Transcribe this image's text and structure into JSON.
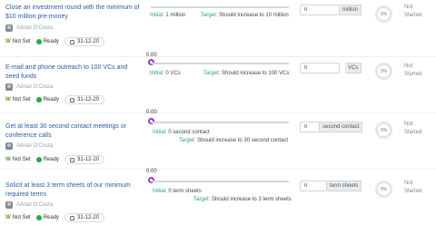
{
  "rows": [
    {
      "title": "Close an investment round with the minimum of $10 million pre-money",
      "owner": "Adrian D'Costa",
      "w_label": "W",
      "not_set": "Not Set",
      "ready": "Ready",
      "date": "31-12-20",
      "slider_value": "0.00",
      "initial_label": "Initial:",
      "initial_value": "1 million",
      "target_label": "Target:",
      "target_value": "Should increase to 10 million",
      "input_value": "0",
      "unit": "million",
      "progress": "0%",
      "status": "Not Started"
    },
    {
      "title": "E-mail and phone outreach to 100 VCs and seed funds",
      "owner": "Adrian D'Costa",
      "w_label": "W",
      "not_set": "Not Set",
      "ready": "Ready",
      "date": "31-12-20",
      "slider_value": "0.00",
      "initial_label": "Initial:",
      "initial_value": "0 VCs",
      "target_label": "Target:",
      "target_value": "Should increase to 100 VCs",
      "input_value": "0",
      "unit": "VCs",
      "progress": "0%",
      "status": "Not Started"
    },
    {
      "title": "Get at least 30 second contact meetings or conference calls",
      "owner": "Adrian D'Costa",
      "w_label": "W",
      "not_set": "Not Set",
      "ready": "Ready",
      "date": "31-12-20",
      "slider_value": "0.00",
      "initial_label": "Initial:",
      "initial_value": "0 second contact",
      "target_label": "Target:",
      "target_value": "Should increase to 30 second contact",
      "input_value": "0",
      "unit": "second contact",
      "progress": "0%",
      "status": "Not Started"
    },
    {
      "title": "Solicit at least 3 term sheets of our minimum required terms",
      "owner": "Adrian D'Costa",
      "w_label": "W",
      "not_set": "Not Set",
      "ready": "Ready",
      "date": "31-12-20",
      "slider_value": "0.00",
      "initial_label": "Initial:",
      "initial_value": "0 term sheets",
      "target_label": "Target:",
      "target_value": "Should increase to 3 term sheets",
      "input_value": "0",
      "unit": "term sheets",
      "progress": "0%",
      "status": "Not Started"
    }
  ]
}
